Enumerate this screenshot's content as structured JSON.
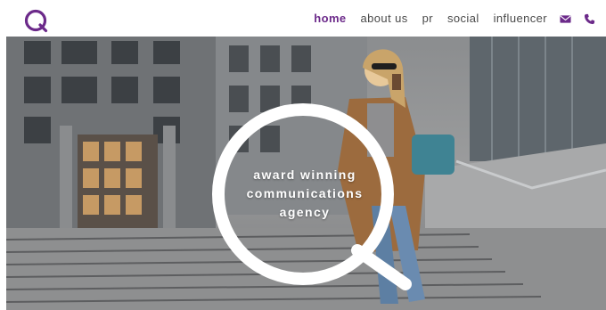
{
  "brand": {
    "logo_icon": "q-logo-icon",
    "accent_color": "#6c2a8a"
  },
  "nav": {
    "items": [
      {
        "label": "home",
        "active": true
      },
      {
        "label": "about us",
        "active": false
      },
      {
        "label": "pr",
        "active": false
      },
      {
        "label": "social",
        "active": false
      },
      {
        "label": "influencer",
        "active": false
      }
    ],
    "icons": [
      "envelope-icon",
      "phone-icon"
    ]
  },
  "hero": {
    "tagline_lines": [
      "award winning",
      "communications",
      "agency"
    ],
    "image": "woman-walking-down-stairs-photo"
  }
}
